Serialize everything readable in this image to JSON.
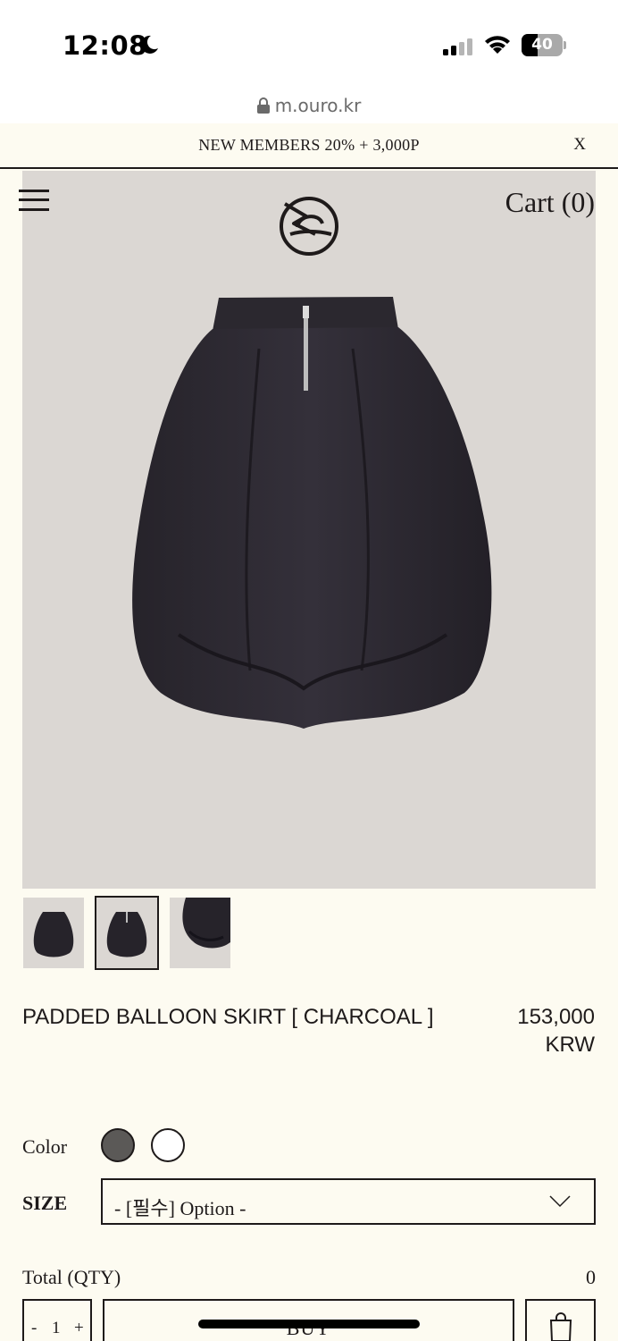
{
  "status_bar": {
    "time": "12:08",
    "battery_percent": "40",
    "battery_level": 0.4,
    "icons": [
      "moon-icon",
      "signal-icon",
      "wifi-icon",
      "battery-icon"
    ]
  },
  "browser": {
    "url": "m.ouro.kr"
  },
  "promo": {
    "text": "NEW MEMBERS 20% + 3,000P",
    "close_label": "X"
  },
  "header": {
    "cart_label": "Cart (0)",
    "menu_icon": "hamburger-menu-icon",
    "logo_icon": "ouro-logo"
  },
  "gallery": {
    "thumbnail_count": 3,
    "active_index": 1
  },
  "product": {
    "name": "PADDED BALLOON SKIRT [ CHARCOAL ]",
    "price": "153,000 KRW"
  },
  "options": {
    "color_label": "Color",
    "colors": [
      {
        "name": "charcoal",
        "hex": "#5b5957"
      },
      {
        "name": "white",
        "hex": "#ffffff"
      }
    ],
    "size_label": "SIZE",
    "size_value": "- [필수] Option -"
  },
  "total": {
    "label": "Total (QTY)",
    "qty": "0"
  },
  "actions": {
    "qty_minus": "-",
    "qty_value": "1",
    "qty_plus": "+",
    "buy_label": "BUY",
    "bag_icon": "shopping-bag-icon"
  },
  "colors": {
    "background": "#fdfbf1",
    "image_bg": "#dbd7d3",
    "text": "#1e1a1a"
  }
}
